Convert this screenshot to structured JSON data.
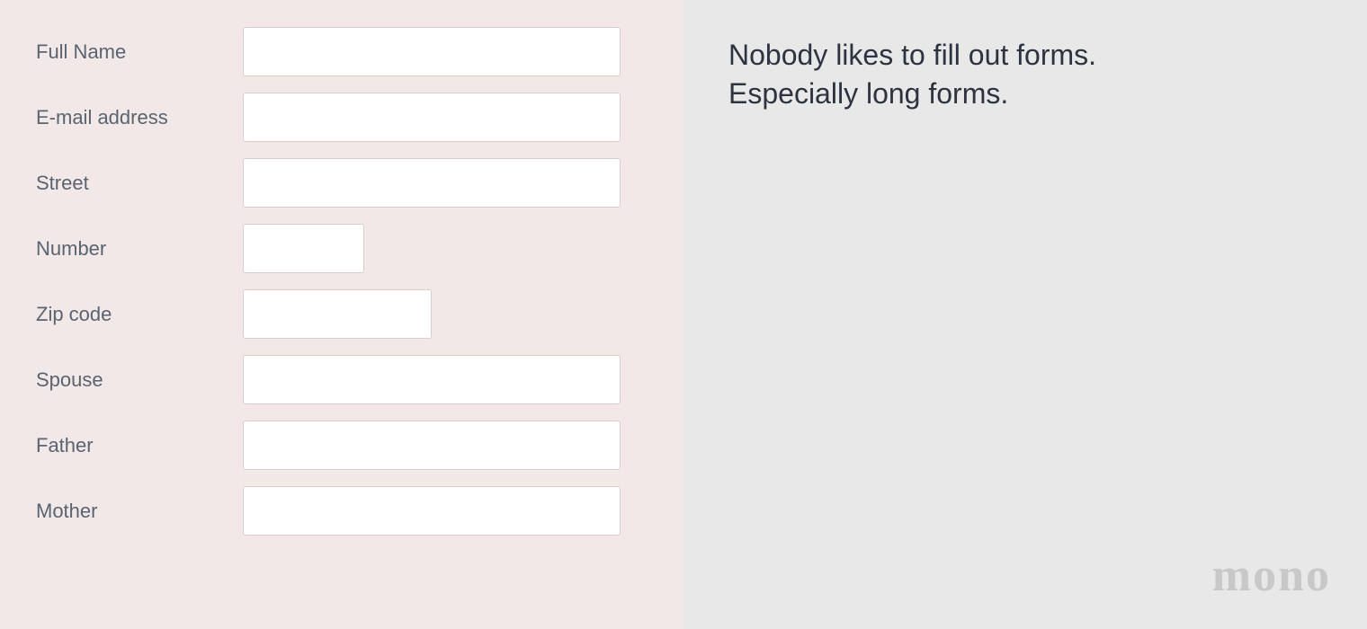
{
  "form": {
    "labels": {
      "fullName": "Full Name",
      "email": "E-mail address",
      "street": "Street",
      "number": "Number",
      "zipCode": "Zip code",
      "spouse": "Spouse",
      "father": "Father",
      "mother": "Mother"
    }
  },
  "rightPanel": {
    "tagline": "Nobody likes to fill out forms.\nEspecially long forms.",
    "logo": "mono"
  }
}
